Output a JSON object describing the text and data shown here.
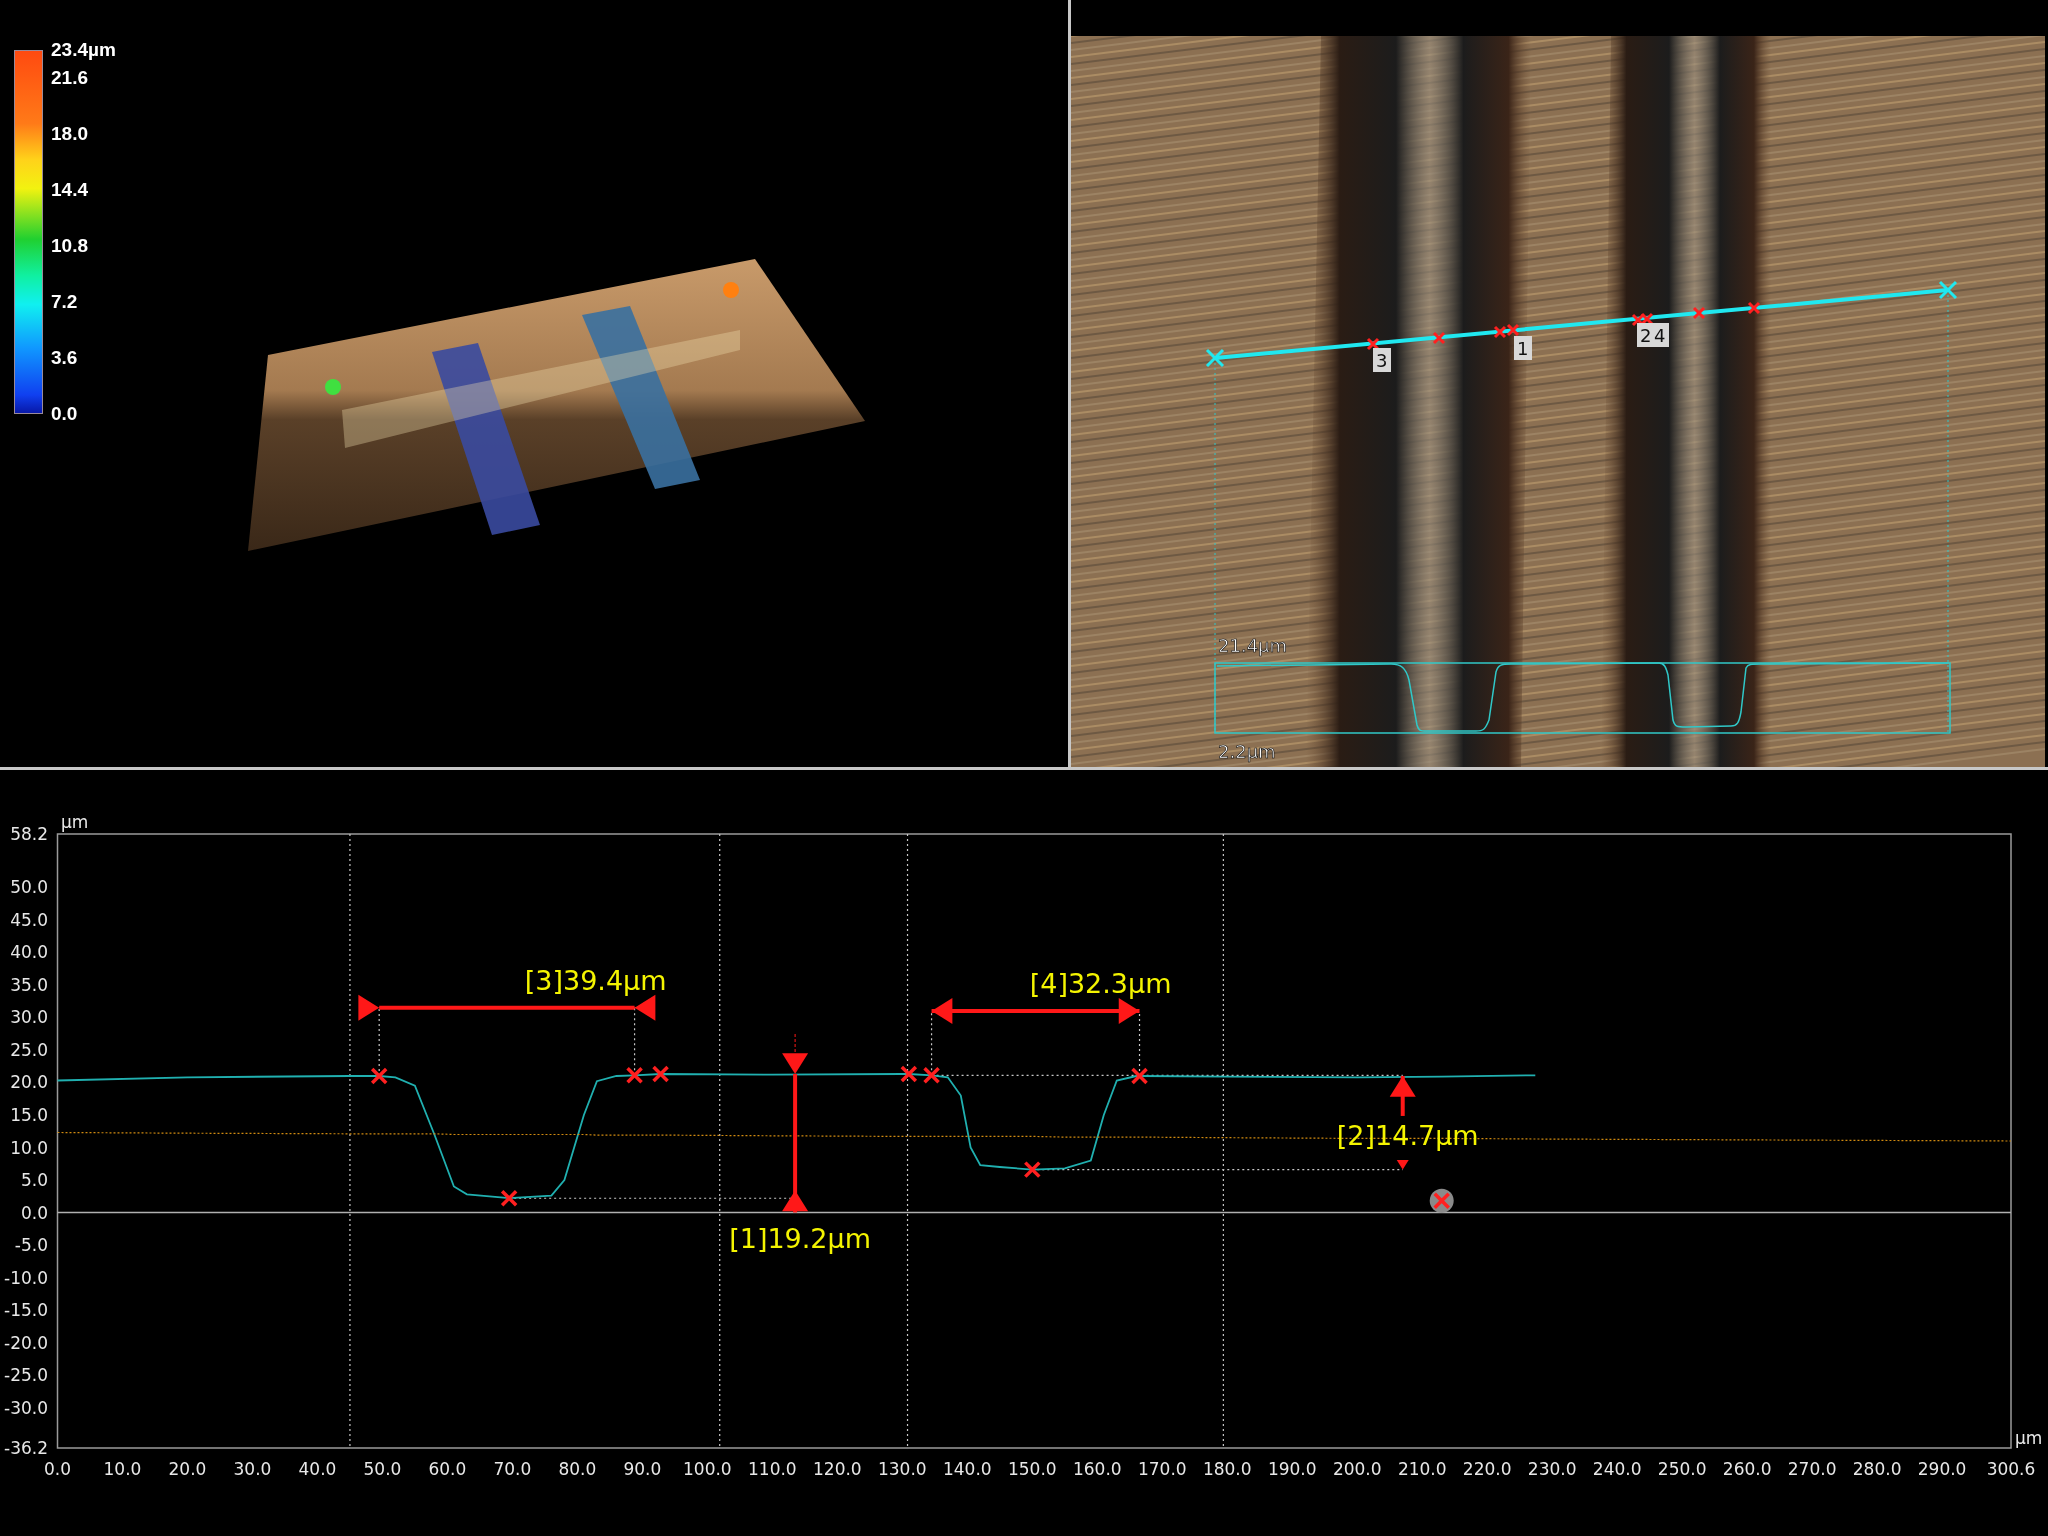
{
  "color_scale": {
    "labels": [
      "23.4µm",
      "21.6",
      "18.0",
      "14.4",
      "10.8",
      "7.2",
      "3.6",
      "0.0"
    ]
  },
  "image_view": {
    "point_labels": [
      "3",
      "1",
      "2",
      "4"
    ],
    "profile_max": "21.4µm",
    "profile_min": "2.2µm"
  },
  "profile_chart": {
    "chart_data": {
      "type": "line",
      "xlabel": "µm",
      "ylabel": "µm",
      "x": [
        0,
        20,
        45,
        49.5,
        52,
        55,
        58,
        61,
        63,
        69.5,
        76,
        78,
        81,
        83,
        86,
        88.8,
        92.8,
        110,
        130,
        131,
        134.5,
        137,
        139,
        140.5,
        142,
        145,
        150,
        155,
        159,
        161,
        163,
        166,
        166.5,
        180,
        200,
        213,
        227.4,
        300.6
      ],
      "series": [
        {
          "color": "#20b0b0",
          "values": [
            20.3,
            20.8,
            21.0,
            21.0,
            20.8,
            19.5,
            12,
            4,
            2.8,
            2.2,
            2.6,
            5,
            15,
            20.2,
            21.0,
            21.1,
            21.3,
            21.2,
            21.3,
            21.3,
            21.1,
            20.8,
            18,
            10,
            7.3,
            7.0,
            6.6,
            6.8,
            8,
            15,
            20.3,
            21.0,
            21.0,
            20.9,
            20.8,
            20.9,
            21.1,
            null
          ]
        },
        {
          "color": "#d08a10",
          "line_style": "dashed",
          "values": [
            12.3,
            12.2,
            12.1,
            12.1,
            12.1,
            12.1,
            12.1,
            12.0,
            12.0,
            12.0,
            12.0,
            12.0,
            12.0,
            11.9,
            11.9,
            11.9,
            11.9,
            11.8,
            11.7,
            11.7,
            11.7,
            11.7,
            11.7,
            11.7,
            11.7,
            11.7,
            11.7,
            11.6,
            11.6,
            11.6,
            11.6,
            11.6,
            11.6,
            11.5,
            11.4,
            11.4,
            11.3,
            11.0
          ]
        },
        {
          "color": "#ff2020",
          "values": [
            null,
            null,
            null,
            21.0,
            null,
            null,
            null,
            null,
            null,
            2.2,
            null,
            null,
            null,
            null,
            null,
            21.1,
            21.3,
            null,
            null,
            21.3,
            21.1,
            null,
            null,
            null,
            null,
            null,
            6.6,
            null,
            null,
            null,
            null,
            null,
            21.0,
            null,
            null,
            1.8,
            null,
            null
          ]
        }
      ],
      "xlim": [
        0,
        300.6
      ],
      "ylim": [
        -36.2,
        58.2
      ],
      "xticks": [
        {
          "value": 0,
          "label": "0.0"
        },
        {
          "value": 10,
          "label": "10.0"
        },
        {
          "value": 20,
          "label": "20.0"
        },
        {
          "value": 30,
          "label": "30.0"
        },
        {
          "value": 40,
          "label": "40.0"
        },
        {
          "value": 50,
          "label": "50.0"
        },
        {
          "value": 60,
          "label": "60.0"
        },
        {
          "value": 70,
          "label": "70.0"
        },
        {
          "value": 80,
          "label": "80.0"
        },
        {
          "value": 90,
          "label": "90.0"
        },
        {
          "value": 100,
          "label": "100.0"
        },
        {
          "value": 110,
          "label": "110.0"
        },
        {
          "value": 120,
          "label": "120.0"
        },
        {
          "value": 130,
          "label": "130.0"
        },
        {
          "value": 140,
          "label": "140.0"
        },
        {
          "value": 150,
          "label": "150.0"
        },
        {
          "value": 160,
          "label": "160.0"
        },
        {
          "value": 170,
          "label": "170.0"
        },
        {
          "value": 180,
          "label": "180.0"
        },
        {
          "value": 190,
          "label": "190.0"
        },
        {
          "value": 200,
          "label": "200.0"
        },
        {
          "value": 210,
          "label": "210.0"
        },
        {
          "value": 220,
          "label": "220.0"
        },
        {
          "value": 230,
          "label": "230.0"
        },
        {
          "value": 240,
          "label": "240.0"
        },
        {
          "value": 250,
          "label": "250.0"
        },
        {
          "value": 260,
          "label": "260.0"
        },
        {
          "value": 270,
          "label": "270.0"
        },
        {
          "value": 280,
          "label": "280.0"
        },
        {
          "value": 290,
          "label": "290.0"
        },
        {
          "value": 300.6,
          "label": "300.6"
        }
      ],
      "yticks": [
        {
          "value": 58.2,
          "label": "58.2"
        },
        {
          "value": 50,
          "label": "50.0"
        },
        {
          "value": 45,
          "label": "45.0"
        },
        {
          "value": 40,
          "label": "40.0"
        },
        {
          "value": 35,
          "label": "35.0"
        },
        {
          "value": 30,
          "label": "30.0"
        },
        {
          "value": 25,
          "label": "25.0"
        },
        {
          "value": 20,
          "label": "20.0"
        },
        {
          "value": 15,
          "label": "15.0"
        },
        {
          "value": 10,
          "label": "10.0"
        },
        {
          "value": 5,
          "label": "5.0"
        },
        {
          "value": 0,
          "label": "0.0"
        },
        {
          "value": -5,
          "label": "-5.0"
        },
        {
          "value": -10,
          "label": "-10.0"
        },
        {
          "value": -15,
          "label": "-15.0"
        },
        {
          "value": -20,
          "label": "-20.0"
        },
        {
          "value": -25,
          "label": "-25.0"
        },
        {
          "value": -30,
          "label": "-30.0"
        },
        {
          "value": -36.2,
          "label": "-36.2"
        }
      ],
      "annotations": [
        "[3]39.4µm",
        "[4]32.3µm",
        "[1]19.2µm",
        "[2]14.7µm"
      ]
    }
  }
}
